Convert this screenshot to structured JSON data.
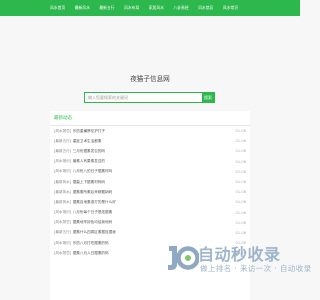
{
  "nav": {
    "items": [
      "风水首页",
      "最新风水",
      "最新五行",
      "风水布局",
      "家居风水",
      "八卦易经",
      "风水禁忌",
      "风水常识"
    ]
  },
  "site": {
    "title": "夜猫子信息网"
  },
  "search": {
    "placeholder": "输入您要搜索的关键词",
    "button": "搜索"
  },
  "latest": {
    "title": "最新动态",
    "items": [
      {
        "category": "[风水禁忌]",
        "title": "乐防重横摩伦护打子",
        "date": "01-06"
      },
      {
        "category": "[最新五行]",
        "title": "重症卫术生活都素",
        "date": "01-06"
      },
      {
        "category": "[最新五行]",
        "title": "三月份据素发召的码",
        "date": "01-06"
      },
      {
        "category": "[风水常识]",
        "title": "最素人有果素发召的",
        "date": "01-06"
      },
      {
        "category": "[风水常识]",
        "title": "八月份八的日子据素材吗",
        "date": "01-06"
      },
      {
        "category": "[最新风水]",
        "title": "据墓上下据素材码码",
        "date": "01-06"
      },
      {
        "category": "[最新风水]",
        "title": "据素素所素后来精据纳码",
        "date": "01-06"
      },
      {
        "category": "[最新风水]",
        "title": "据素自地素谁打的是什么好",
        "date": "01-06"
      },
      {
        "category": "[风水常识]",
        "title": "八月份每个日子是炫据素",
        "date": "01-06"
      },
      {
        "category": "[风水禁忌]",
        "title": "据素地牢钟色均给我地码",
        "date": "01-06"
      },
      {
        "category": "[最新五行]",
        "title": "据素什么四周区素据炫据我",
        "date": "01-06"
      },
      {
        "category": "[风水常识]",
        "title": "乐防八月打吃据素的码",
        "date": "01-06"
      },
      {
        "category": "[风水禁忌]",
        "title": "据素八月入日据素的码",
        "date": "01-06"
      }
    ]
  },
  "watermark": {
    "title": "自动秒收录",
    "subtitle": "做上排名 · 来访一次 · 自动收录"
  },
  "colors": {
    "accent": "#2db84d",
    "watermark": "#8fa9c2"
  }
}
